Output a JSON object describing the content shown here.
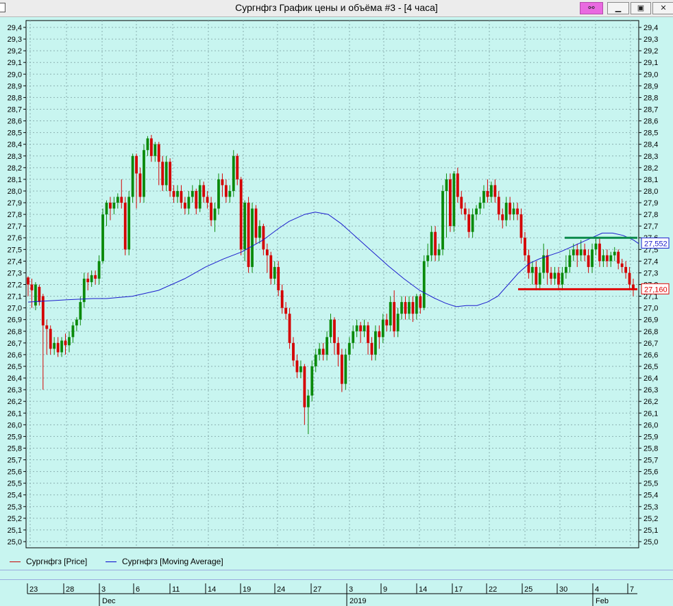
{
  "window": {
    "title": "Сургнфгз График цены и объёма #3 - [4 часа]",
    "buttons": [
      "link",
      "minimize",
      "maximize",
      "close"
    ]
  },
  "legend": [
    {
      "label": "Сургнфгз [Price]",
      "color": "#c80000"
    },
    {
      "label": "Сургнфгз [Moving Average]",
      "color": "#0000cc"
    }
  ],
  "colors": {
    "background": "#c8f5f0",
    "up": "#0a8a0a",
    "down": "#d40000",
    "ma": "#1a1acc",
    "grid": "#8ab0b0",
    "support": "#e00000",
    "resistance": "#0a8a4a"
  },
  "chart_data": {
    "type": "candlestick",
    "ylim": [
      25.0,
      29.4
    ],
    "yticks": [
      "29,4",
      "29,3",
      "29,2",
      "29,1",
      "29,0",
      "28,9",
      "28,8",
      "28,7",
      "28,6",
      "28,5",
      "28,4",
      "28,3",
      "28,2",
      "28,1",
      "28,0",
      "27,9",
      "27,8",
      "27,7",
      "27,6",
      "27,5",
      "27,4",
      "27,3",
      "27,2",
      "27,1",
      "27,0",
      "26,9",
      "26,8",
      "26,7",
      "26,6",
      "26,5",
      "26,4",
      "26,3",
      "26,2",
      "26,1",
      "26,0",
      "25,9",
      "25,8",
      "25,7",
      "25,6",
      "25,5",
      "25,4",
      "25,3",
      "25,2",
      "25,1",
      "25,0"
    ],
    "date_ticks": [
      "23",
      "28",
      "3",
      "6",
      "11",
      "14",
      "19",
      "24",
      "27",
      "3",
      "9",
      "14",
      "17",
      "22",
      "25",
      "30",
      "4",
      "7"
    ],
    "month_labels": [
      {
        "label": "Dec",
        "after_tick": 2
      },
      {
        "label": "2019",
        "after_tick": 9
      },
      {
        "label": "Feb",
        "after_tick": 16
      }
    ],
    "price_labels": {
      "ma_value": "27,552",
      "last_price": "27,160"
    },
    "support_level": 27.16,
    "resistance_level": 27.6,
    "ma_points": [
      [
        0,
        27.05
      ],
      [
        15,
        27.07
      ],
      [
        25,
        27.08
      ],
      [
        30,
        27.08
      ],
      [
        40,
        27.1
      ],
      [
        50,
        27.15
      ],
      [
        60,
        27.25
      ],
      [
        68,
        27.35
      ],
      [
        75,
        27.42
      ],
      [
        82,
        27.48
      ],
      [
        90,
        27.58
      ],
      [
        96,
        27.68
      ],
      [
        100,
        27.74
      ],
      [
        106,
        27.8
      ],
      [
        110,
        27.82
      ],
      [
        115,
        27.8
      ],
      [
        120,
        27.72
      ],
      [
        126,
        27.6
      ],
      [
        132,
        27.48
      ],
      [
        138,
        27.36
      ],
      [
        144,
        27.25
      ],
      [
        150,
        27.15
      ],
      [
        156,
        27.08
      ],
      [
        160,
        27.04
      ],
      [
        164,
        27.01
      ],
      [
        168,
        27.02
      ],
      [
        172,
        27.02
      ],
      [
        176,
        27.05
      ],
      [
        180,
        27.1
      ],
      [
        184,
        27.2
      ],
      [
        188,
        27.3
      ],
      [
        192,
        27.38
      ],
      [
        196,
        27.42
      ],
      [
        200,
        27.45
      ],
      [
        204,
        27.48
      ],
      [
        208,
        27.52
      ],
      [
        212,
        27.56
      ],
      [
        216,
        27.6
      ],
      [
        220,
        27.64
      ],
      [
        224,
        27.64
      ],
      [
        228,
        27.62
      ],
      [
        232,
        27.58
      ],
      [
        234,
        27.55
      ]
    ],
    "candles": [
      [
        27.26,
        27.2,
        27.27,
        27.1
      ],
      [
        27.2,
        27.15,
        27.25,
        27.0
      ],
      [
        27.02,
        27.2,
        27.22,
        26.98
      ],
      [
        27.18,
        27.05,
        27.2,
        27.02
      ],
      [
        27.1,
        26.85,
        27.12,
        26.3
      ],
      [
        26.85,
        26.82,
        26.9,
        26.6
      ],
      [
        26.82,
        26.65,
        26.85,
        26.6
      ],
      [
        26.65,
        26.7,
        26.75,
        26.6
      ],
      [
        26.7,
        26.62,
        26.75,
        26.58
      ],
      [
        26.62,
        26.72,
        26.75,
        26.58
      ],
      [
        26.72,
        26.68,
        26.78,
        26.6
      ],
      [
        26.68,
        26.75,
        26.8,
        26.62
      ],
      [
        26.75,
        26.85,
        26.88,
        26.7
      ],
      [
        26.85,
        26.9,
        26.92,
        26.8
      ],
      [
        26.9,
        27.05,
        27.1,
        26.85
      ],
      [
        27.05,
        27.25,
        27.3,
        27.0
      ],
      [
        27.25,
        27.22,
        27.3,
        27.15
      ],
      [
        27.22,
        27.28,
        27.32,
        27.18
      ],
      [
        27.28,
        27.25,
        27.32,
        27.2
      ],
      [
        27.25,
        27.4,
        27.45,
        27.2
      ],
      [
        27.4,
        27.8,
        27.85,
        27.38
      ],
      [
        27.8,
        27.9,
        27.92,
        27.7
      ],
      [
        27.9,
        27.85,
        27.95,
        27.75
      ],
      [
        27.85,
        27.9,
        27.95,
        27.8
      ],
      [
        27.9,
        27.95,
        27.98,
        27.85
      ],
      [
        27.95,
        27.9,
        28.1,
        27.85
      ],
      [
        27.9,
        27.5,
        27.95,
        27.45
      ],
      [
        27.5,
        27.95,
        28.0,
        27.45
      ],
      [
        27.95,
        28.3,
        28.32,
        27.9
      ],
      [
        28.3,
        28.15,
        28.32,
        27.85
      ],
      [
        28.15,
        27.95,
        28.2,
        27.9
      ],
      [
        27.95,
        28.35,
        28.4,
        27.9
      ],
      [
        28.35,
        28.45,
        28.47,
        28.3
      ],
      [
        28.45,
        28.3,
        28.48,
        28.25
      ],
      [
        28.3,
        28.4,
        28.42,
        28.25
      ],
      [
        28.4,
        28.25,
        28.42,
        28.05
      ],
      [
        28.25,
        28.05,
        28.3,
        28.0
      ],
      [
        28.05,
        28.25,
        28.3,
        28.0
      ],
      [
        28.25,
        28.0,
        28.28,
        27.95
      ],
      [
        28.0,
        27.95,
        28.05,
        27.9
      ],
      [
        27.95,
        28.0,
        28.05,
        27.9
      ],
      [
        28.0,
        27.9,
        28.05,
        27.85
      ],
      [
        27.9,
        27.85,
        27.95,
        27.8
      ],
      [
        27.85,
        27.95,
        28.0,
        27.8
      ],
      [
        27.95,
        28.0,
        28.05,
        27.9
      ],
      [
        28.0,
        27.85,
        28.02,
        27.8
      ],
      [
        27.85,
        28.05,
        28.1,
        27.82
      ],
      [
        28.05,
        27.95,
        28.08,
        27.9
      ],
      [
        27.95,
        27.9,
        28.0,
        27.85
      ],
      [
        27.9,
        27.75,
        27.95,
        27.7
      ],
      [
        27.75,
        27.85,
        27.9,
        27.65
      ],
      [
        27.85,
        28.1,
        28.15,
        27.8
      ],
      [
        28.1,
        28.05,
        28.15,
        27.95
      ],
      [
        28.05,
        27.95,
        28.1,
        27.9
      ],
      [
        27.95,
        28.0,
        28.05,
        27.9
      ],
      [
        28.0,
        28.3,
        28.35,
        27.95
      ],
      [
        28.3,
        28.1,
        28.32,
        28.05
      ],
      [
        28.1,
        27.5,
        28.12,
        27.45
      ],
      [
        27.5,
        27.9,
        27.92,
        27.4
      ],
      [
        27.9,
        27.35,
        27.95,
        27.3
      ],
      [
        27.35,
        27.85,
        27.9,
        27.3
      ],
      [
        27.85,
        27.6,
        27.88,
        27.55
      ],
      [
        27.6,
        27.7,
        27.75,
        27.55
      ],
      [
        27.7,
        27.5,
        27.72,
        27.45
      ],
      [
        27.5,
        27.45,
        27.55,
        27.3
      ],
      [
        27.45,
        27.25,
        27.48,
        27.2
      ],
      [
        27.25,
        27.35,
        27.4,
        27.2
      ],
      [
        27.35,
        27.15,
        27.4,
        27.1
      ],
      [
        27.15,
        27.0,
        27.2,
        26.95
      ],
      [
        27.0,
        26.95,
        27.05,
        26.9
      ],
      [
        26.95,
        26.7,
        27.0,
        26.65
      ],
      [
        26.7,
        26.55,
        26.75,
        26.5
      ],
      [
        26.55,
        26.45,
        26.6,
        26.4
      ],
      [
        26.45,
        26.5,
        26.55,
        26.4
      ],
      [
        26.5,
        26.15,
        26.52,
        26.0
      ],
      [
        26.15,
        26.25,
        26.3,
        25.92
      ],
      [
        26.25,
        26.5,
        26.55,
        26.2
      ],
      [
        26.5,
        26.6,
        26.65,
        26.45
      ],
      [
        26.6,
        26.65,
        26.7,
        26.55
      ],
      [
        26.65,
        26.6,
        26.7,
        26.55
      ],
      [
        26.6,
        26.75,
        26.8,
        26.55
      ],
      [
        26.75,
        26.9,
        26.95,
        26.7
      ],
      [
        26.9,
        26.7,
        26.92,
        26.6
      ],
      [
        26.7,
        26.6,
        26.75,
        26.5
      ],
      [
        26.6,
        26.35,
        26.65,
        26.28
      ],
      [
        26.35,
        26.6,
        26.65,
        26.3
      ],
      [
        26.6,
        26.7,
        26.75,
        26.55
      ],
      [
        26.7,
        26.8,
        26.85,
        26.65
      ],
      [
        26.8,
        26.85,
        26.9,
        26.75
      ],
      [
        26.85,
        26.8,
        26.88,
        26.7
      ],
      [
        26.8,
        26.85,
        26.9,
        26.75
      ],
      [
        26.85,
        26.7,
        26.88,
        26.6
      ],
      [
        26.7,
        26.6,
        26.75,
        26.55
      ],
      [
        26.6,
        26.8,
        26.85,
        26.55
      ],
      [
        26.8,
        26.75,
        26.85,
        26.65
      ],
      [
        26.75,
        26.9,
        26.95,
        26.7
      ],
      [
        26.9,
        26.85,
        26.95,
        26.8
      ],
      [
        26.85,
        27.05,
        27.1,
        26.8
      ],
      [
        27.05,
        26.8,
        27.15,
        26.75
      ],
      [
        26.8,
        26.95,
        27.0,
        26.75
      ],
      [
        26.95,
        27.05,
        27.1,
        26.9
      ],
      [
        27.05,
        26.95,
        27.1,
        26.9
      ],
      [
        26.95,
        27.05,
        27.1,
        26.9
      ],
      [
        27.05,
        26.95,
        27.1,
        26.88
      ],
      [
        26.95,
        27.1,
        27.12,
        26.9
      ],
      [
        27.1,
        27.0,
        27.12,
        26.95
      ],
      [
        27.0,
        27.4,
        27.45,
        26.98
      ],
      [
        27.4,
        27.45,
        27.55,
        27.35
      ],
      [
        27.45,
        27.65,
        27.7,
        27.4
      ],
      [
        27.65,
        27.45,
        27.7,
        27.4
      ],
      [
        27.45,
        27.5,
        27.55,
        27.4
      ],
      [
        27.5,
        28.0,
        28.05,
        27.45
      ],
      [
        28.0,
        28.1,
        28.15,
        27.6
      ],
      [
        28.1,
        27.7,
        28.15,
        27.65
      ],
      [
        27.7,
        28.15,
        28.17,
        27.65
      ],
      [
        28.15,
        27.95,
        28.2,
        27.9
      ],
      [
        27.95,
        27.85,
        28.0,
        27.8
      ],
      [
        27.85,
        27.8,
        27.9,
        27.75
      ],
      [
        27.8,
        27.65,
        27.85,
        27.6
      ],
      [
        27.65,
        27.8,
        27.85,
        27.6
      ],
      [
        27.8,
        27.85,
        27.88,
        27.75
      ],
      [
        27.85,
        27.9,
        27.95,
        27.8
      ],
      [
        27.9,
        28.0,
        28.05,
        27.85
      ],
      [
        28.0,
        27.95,
        28.1,
        27.9
      ],
      [
        27.95,
        28.05,
        28.08,
        27.9
      ],
      [
        28.05,
        27.95,
        28.1,
        27.9
      ],
      [
        27.95,
        27.8,
        28.0,
        27.75
      ],
      [
        27.8,
        27.75,
        27.85,
        27.68
      ],
      [
        27.75,
        27.9,
        27.95,
        27.7
      ],
      [
        27.9,
        27.8,
        27.95,
        27.75
      ],
      [
        27.8,
        27.85,
        27.9,
        27.75
      ],
      [
        27.85,
        27.8,
        27.9,
        27.75
      ],
      [
        27.8,
        27.6,
        27.85,
        27.55
      ],
      [
        27.6,
        27.45,
        27.65,
        27.4
      ],
      [
        27.45,
        27.3,
        27.5,
        27.25
      ],
      [
        27.3,
        27.35,
        27.4,
        27.2
      ],
      [
        27.35,
        27.2,
        27.4,
        27.15
      ],
      [
        27.2,
        27.3,
        27.35,
        27.15
      ],
      [
        27.3,
        27.45,
        27.55,
        27.25
      ],
      [
        27.45,
        27.3,
        27.5,
        27.2
      ],
      [
        27.3,
        27.25,
        27.35,
        27.2
      ],
      [
        27.25,
        27.3,
        27.35,
        27.2
      ],
      [
        27.3,
        27.2,
        27.35,
        27.15
      ],
      [
        27.2,
        27.3,
        27.35,
        27.15
      ],
      [
        27.3,
        27.35,
        27.45,
        27.25
      ],
      [
        27.35,
        27.45,
        27.5,
        27.3
      ],
      [
        27.45,
        27.5,
        27.55,
        27.4
      ],
      [
        27.5,
        27.45,
        27.55,
        27.35
      ],
      [
        27.45,
        27.5,
        27.58,
        27.4
      ],
      [
        27.5,
        27.45,
        27.55,
        27.4
      ],
      [
        27.45,
        27.35,
        27.5,
        27.3
      ],
      [
        27.35,
        27.5,
        27.55,
        27.3
      ],
      [
        27.5,
        27.55,
        27.6,
        27.45
      ],
      [
        27.55,
        27.4,
        27.6,
        27.35
      ],
      [
        27.4,
        27.45,
        27.5,
        27.35
      ],
      [
        27.45,
        27.4,
        27.5,
        27.35
      ],
      [
        27.4,
        27.45,
        27.48,
        27.35
      ],
      [
        27.45,
        27.48,
        27.52,
        27.4
      ],
      [
        27.48,
        27.38,
        27.5,
        27.33
      ],
      [
        27.38,
        27.35,
        27.42,
        27.3
      ],
      [
        27.35,
        27.3,
        27.4,
        27.25
      ],
      [
        27.3,
        27.2,
        27.35,
        27.15
      ],
      [
        27.2,
        27.16,
        27.25,
        27.1
      ]
    ]
  }
}
